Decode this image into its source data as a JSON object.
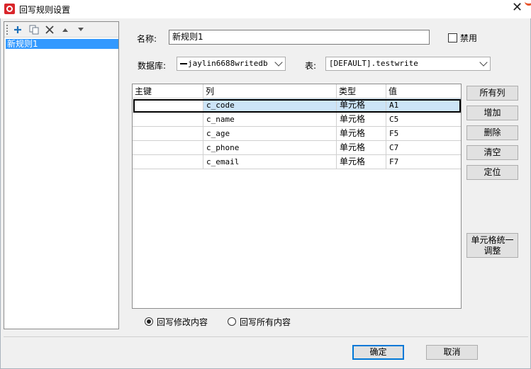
{
  "window": {
    "title": "回写规则设置",
    "close_glyph": "✕"
  },
  "left_panel": {
    "toolbar_icons": [
      "plus-icon",
      "copy-icon",
      "delete-x-icon",
      "move-up-icon",
      "move-down-icon"
    ],
    "rules": [
      "新规则1"
    ]
  },
  "form": {
    "name_label": "名称:",
    "name_value": "新规则1",
    "disable_label": "禁用",
    "disable_checked": false,
    "db_label": "数据库:",
    "db_value": "jaylin6688writedb",
    "table_label": "表:",
    "table_value": "[DEFAULT].testwrite"
  },
  "grid": {
    "headers": [
      "主键",
      "列",
      "类型",
      "值"
    ],
    "rows": [
      {
        "key": "",
        "column": "c_code",
        "type": "单元格",
        "value": "A1"
      },
      {
        "key": "",
        "column": "c_name",
        "type": "单元格",
        "value": "C5"
      },
      {
        "key": "",
        "column": "c_age",
        "type": "单元格",
        "value": "F5"
      },
      {
        "key": "",
        "column": "c_phone",
        "type": "单元格",
        "value": "C7"
      },
      {
        "key": "",
        "column": "c_email",
        "type": "单元格",
        "value": "F7"
      }
    ],
    "selected_row": 0
  },
  "side_buttons": {
    "all_columns": "所有列",
    "add": "增加",
    "delete": "删除",
    "clear": "清空",
    "locate": "定位",
    "unify_cells": "单元格统一调整"
  },
  "write_mode": {
    "modified_label": "回写修改内容",
    "all_label": "回写所有内容",
    "selected": "modified"
  },
  "footer": {
    "ok": "确定",
    "cancel": "取消"
  },
  "colors": {
    "selection": "#3399ff",
    "row_highlight": "#cce4f7",
    "app_icon": "#d9262b"
  }
}
